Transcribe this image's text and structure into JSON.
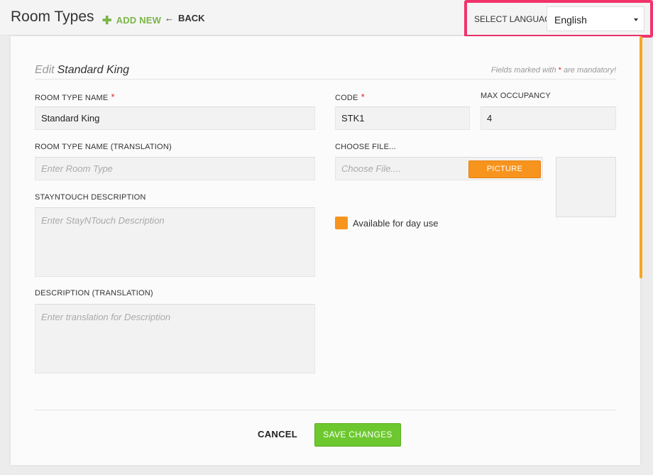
{
  "header": {
    "title": "Room Types",
    "add_new": "ADD NEW",
    "back": "BACK"
  },
  "language": {
    "label": "SELECT LANGUAGE",
    "selected": "English"
  },
  "form": {
    "edit_prefix": "Edit",
    "edit_name": "Standard King",
    "mandatory_pre": "Fields marked with",
    "mandatory_star": "*",
    "mandatory_post": "are mandatory!",
    "required_star": "*",
    "room_type_name": {
      "label": "ROOM TYPE NAME",
      "value": "Standard King"
    },
    "code": {
      "label": "CODE",
      "value": "STK1"
    },
    "max_occupancy": {
      "label": "MAX OCCUPANCY",
      "value": "4"
    },
    "room_type_name_translation": {
      "label": "ROOM TYPE NAME (TRANSLATION)",
      "placeholder": "Enter Room Type"
    },
    "choose_file": {
      "label": "CHOOSE FILE...",
      "placeholder": "Choose File....",
      "button": "PICTURE"
    },
    "stayntouch_description": {
      "label": "STAYNTOUCH DESCRIPTION",
      "placeholder": "Enter StayNTouch Description"
    },
    "description_translation": {
      "label": "DESCRIPTION (TRANSLATION)",
      "placeholder": "Enter translation for Description"
    },
    "day_use": {
      "label": "Available for day use"
    }
  },
  "actions": {
    "cancel": "CANCEL",
    "save": "SAVE CHANGES"
  },
  "colors": {
    "accent_orange": "#f7941d",
    "save_green": "#6cc82e",
    "highlight_pink": "#f0336b",
    "add_new_green": "#7ab648"
  },
  "icons": {
    "add": "plus-icon",
    "back": "arrow-left-icon",
    "dropdown": "caret-down-icon"
  }
}
